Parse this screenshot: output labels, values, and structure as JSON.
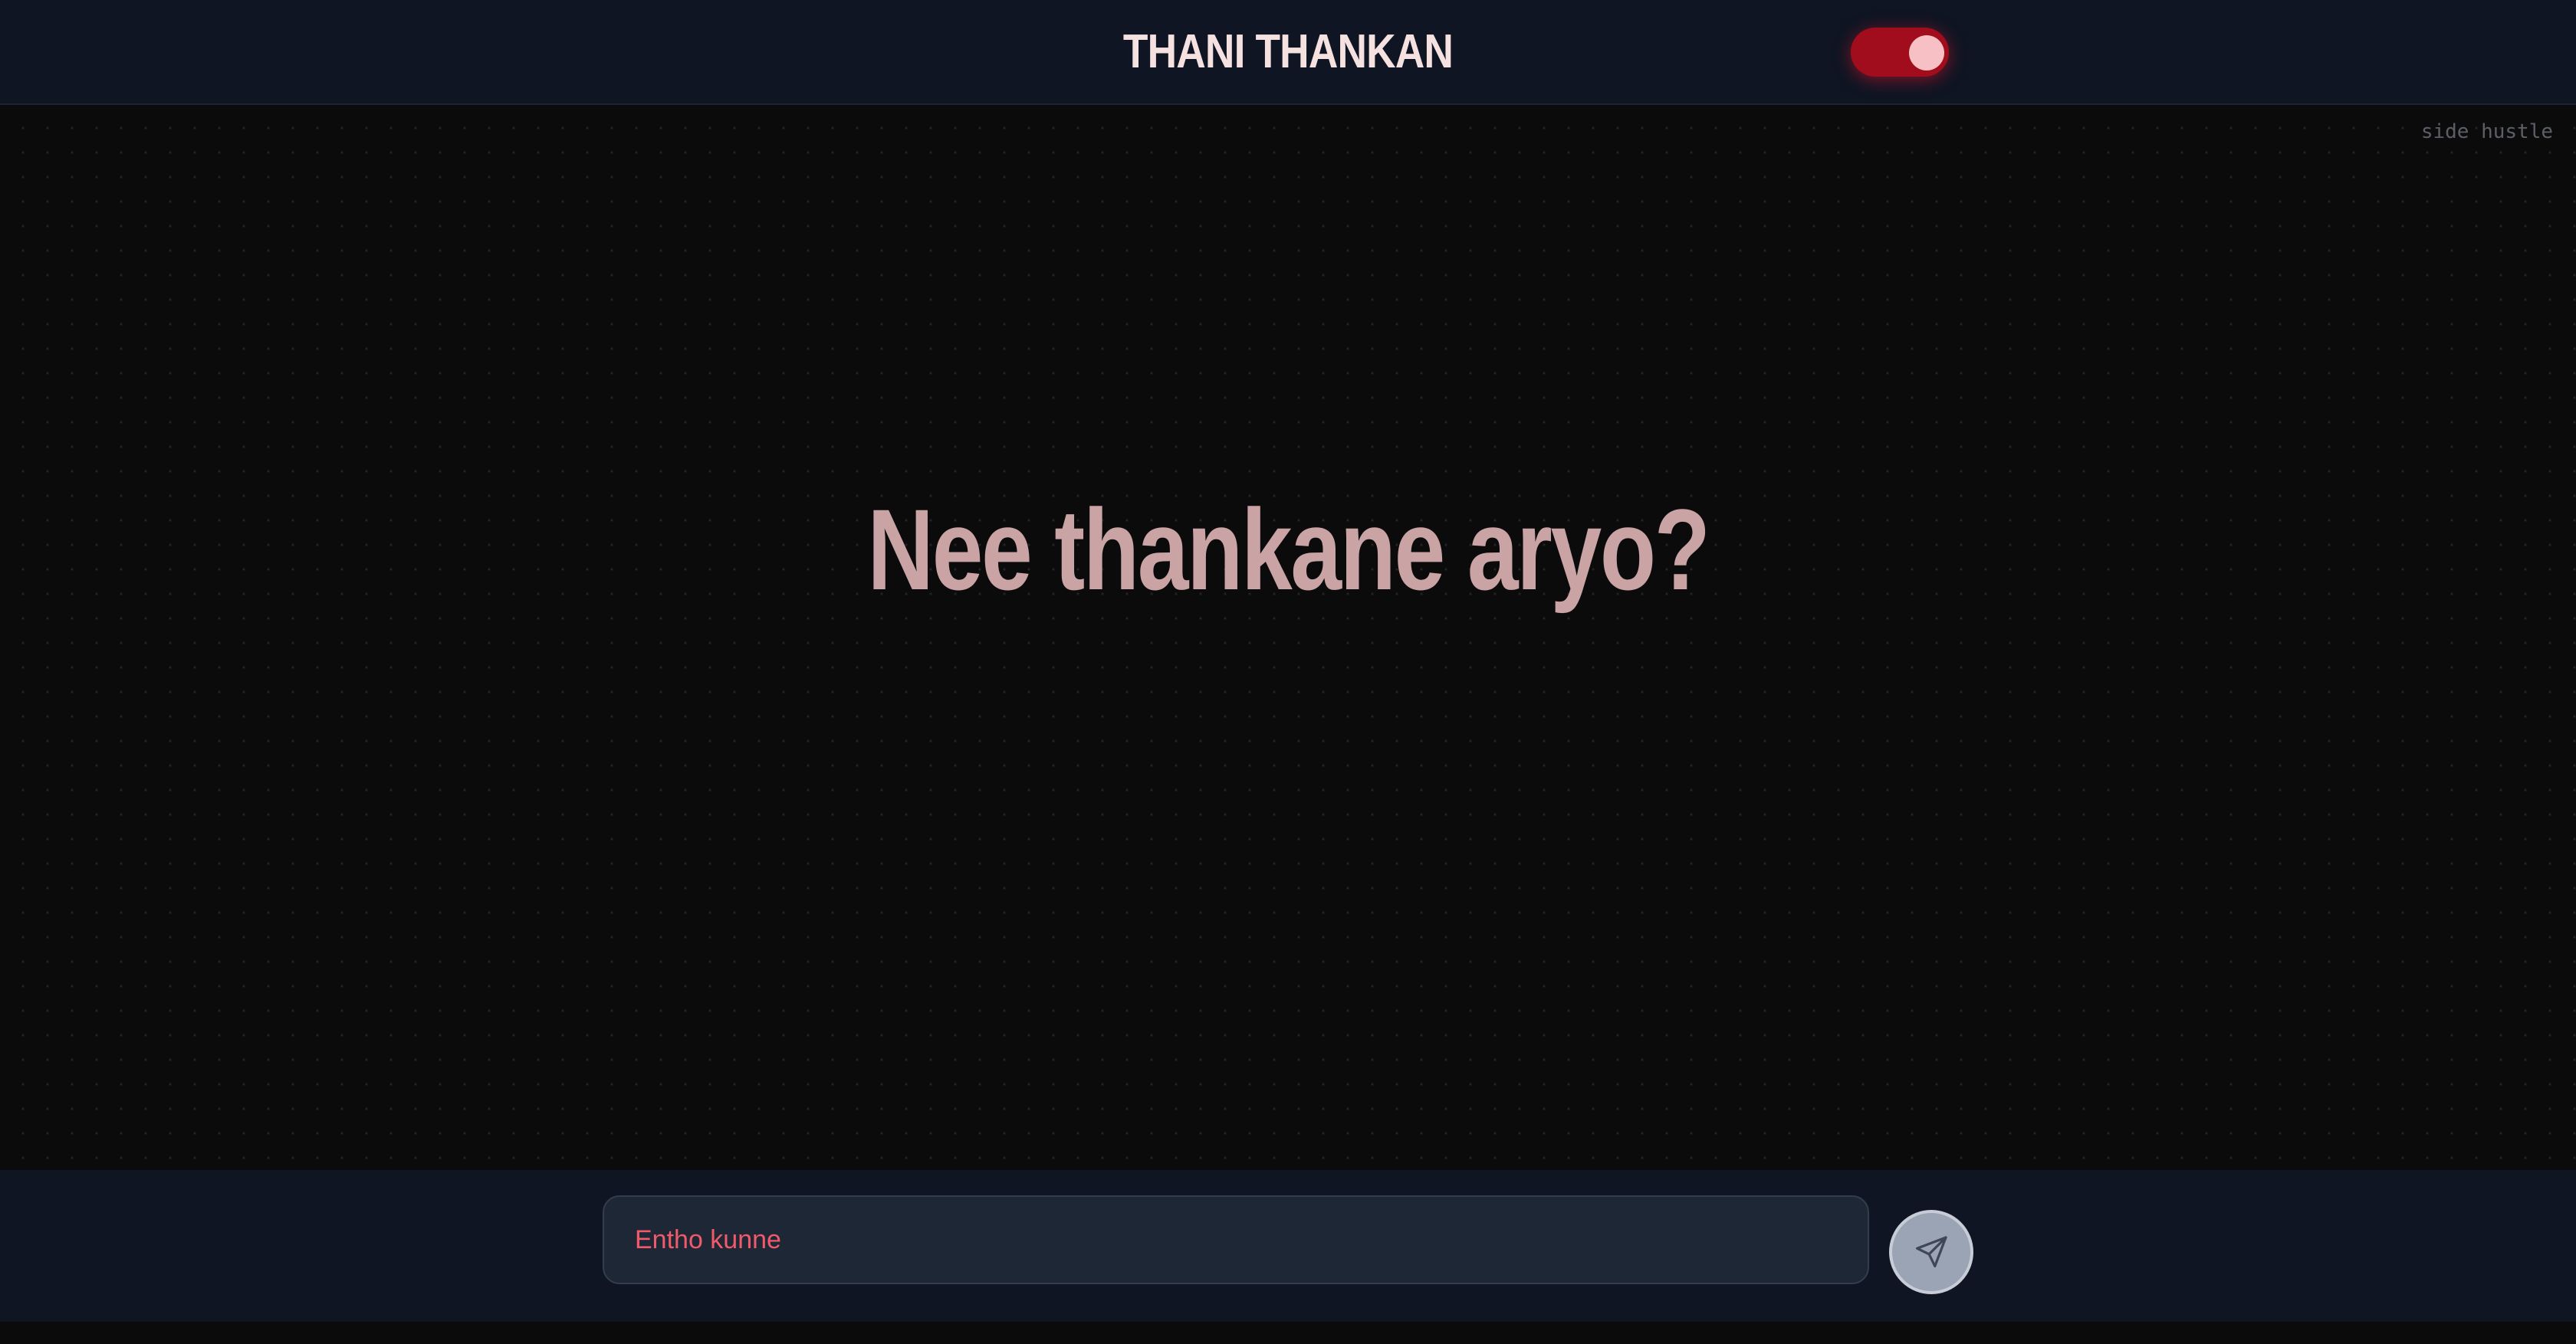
{
  "header": {
    "title": "THANI THANKAN",
    "theme_toggle": {
      "state": "on",
      "icon": "toggle-switch",
      "color": "#a10d1c"
    }
  },
  "main": {
    "corner_note": "side hustle",
    "heading": "Nee thankane aryo?"
  },
  "composer": {
    "placeholder": "Entho kunne",
    "value": "",
    "send_icon": "paper-plane-icon"
  },
  "colors": {
    "accent": "#a10d1c",
    "heading": "#caa3a5",
    "placeholder": "#f05a6a",
    "bar_background": "#0f1523"
  }
}
